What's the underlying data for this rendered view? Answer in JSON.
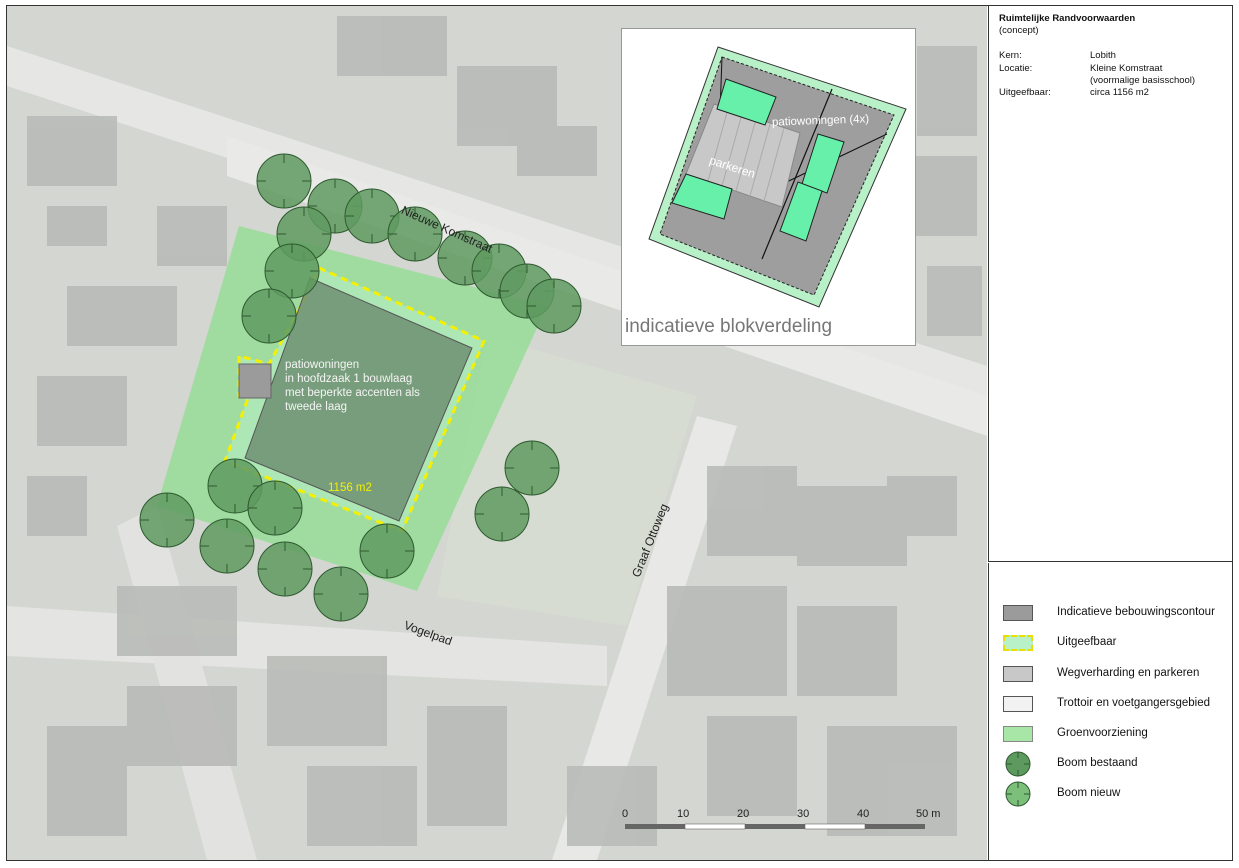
{
  "info": {
    "title": "Ruimtelijke Randvoorwaarden",
    "subtitle": "(concept)",
    "rows": [
      {
        "key": "Kern:",
        "value": "Lobith"
      },
      {
        "key": "Locatie:",
        "value": "Kleine Komstraat"
      },
      {
        "key": "",
        "value": "(voormalige basisschool)"
      },
      {
        "key": "Uitgeefbaar:",
        "value": "circa 1156 m2"
      }
    ]
  },
  "map": {
    "street_labels": {
      "nieuwe_komstraat": "Nieuwe Komstraat",
      "graaf_ottoweg": "Graaf Ottoweg",
      "vogelpad": "Vogelpad"
    },
    "annotation_lines": [
      "patiowoningen",
      "in hoofdzaak 1 bouwlaag",
      "met beperkte accenten als",
      "tweede laag"
    ],
    "area_label": "1156 m2"
  },
  "inset": {
    "title": "indicatieve blokverdeling",
    "label_patio": "patiowoningen (4x)",
    "label_parking": "parkeren"
  },
  "scalebar": {
    "ticks": [
      "0",
      "10",
      "20",
      "30",
      "40",
      "50 m"
    ]
  },
  "legend": {
    "items": [
      {
        "label": "Indicatieve bebouwingscontour",
        "symbol": "gray-box",
        "color": "#9b9b9b"
      },
      {
        "label": "Uitgeefbaar",
        "symbol": "dashed-yellow-box",
        "color": "#b8f0c8"
      },
      {
        "label": "Wegverharding en parkeren",
        "symbol": "lightgray-box",
        "color": "#c8c8c8"
      },
      {
        "label": "Trottoir en voetgangersgebied",
        "symbol": "white-box",
        "color": "#f2f2f2"
      },
      {
        "label": "Groenvoorziening",
        "symbol": "green-box",
        "color": "#a8e6a8"
      },
      {
        "label": "Boom bestaand",
        "symbol": "tree-existing-icon",
        "color": "#5d9a5d"
      },
      {
        "label": "Boom nieuw",
        "symbol": "tree-new-icon",
        "color": "#7bbf7b"
      }
    ]
  },
  "colors": {
    "green_area": "#8fdc8f",
    "building": "#6f8f72",
    "dashed_boundary": "#f5f000",
    "tree": "#5f9a60"
  }
}
